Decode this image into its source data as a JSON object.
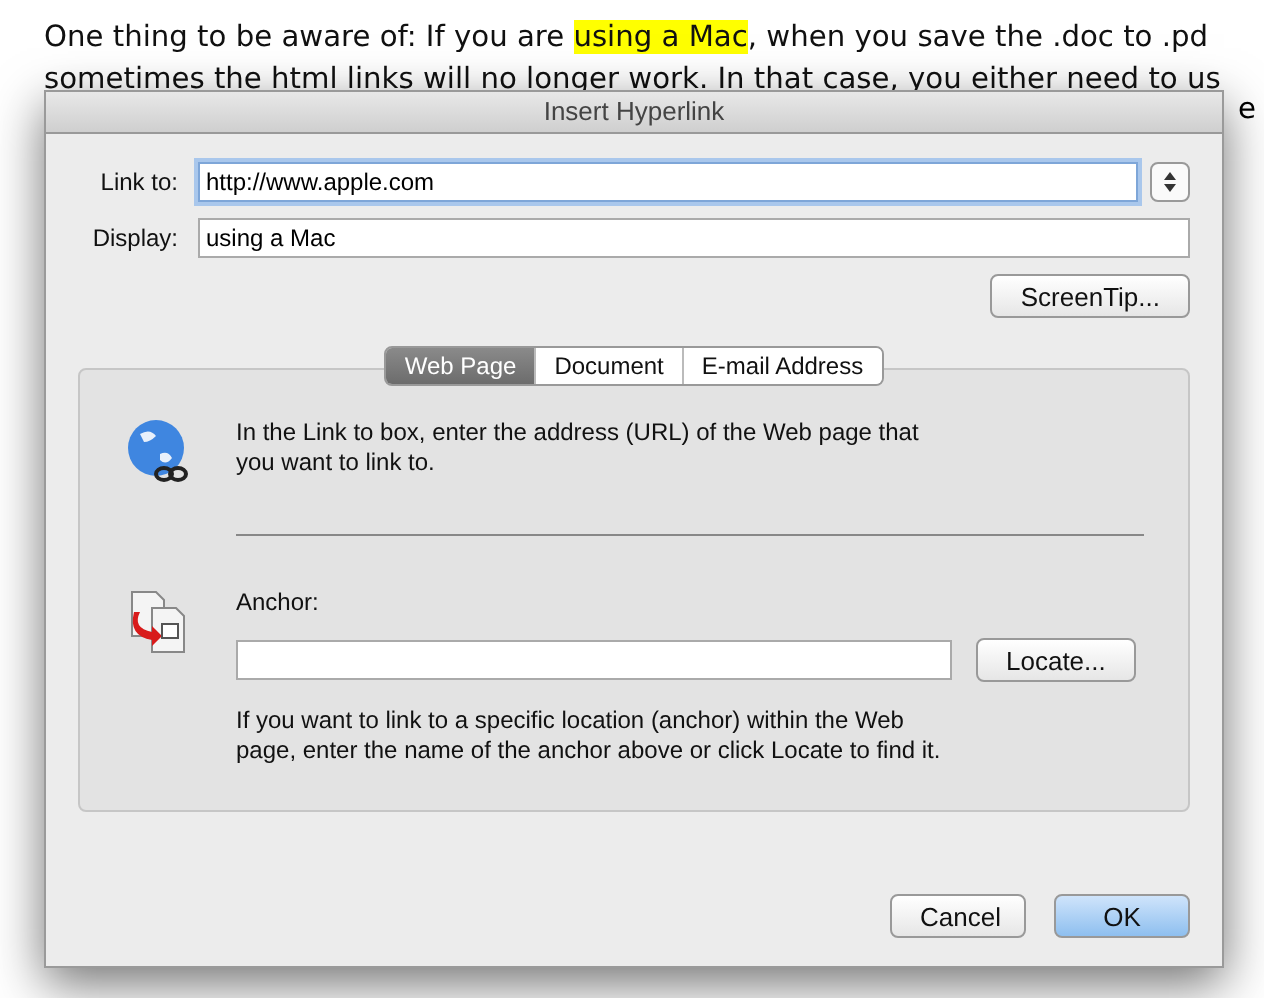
{
  "document": {
    "lines": [
      [
        {
          "text": "One thing to be aware of: If you are ",
          "highlighted": false
        },
        {
          "text": "using a Mac",
          "highlighted": true
        },
        {
          "text": ", when you save the .doc to .pd",
          "highlighted": false
        }
      ],
      [
        {
          "text": "sometimes the html links will no longer work. In that case, you either need to us",
          "highlighted": false
        }
      ]
    ],
    "fragment": "e"
  },
  "dialog": {
    "title": "Insert Hyperlink",
    "link_to": {
      "label": "Link to:",
      "value": "http://www.apple.com"
    },
    "display": {
      "label": "Display:",
      "value": "using a Mac"
    },
    "screentip_button": "ScreenTip...",
    "tabs": [
      {
        "label": "Web Page",
        "selected": true
      },
      {
        "label": "Document",
        "selected": false
      },
      {
        "label": "E-mail Address",
        "selected": false
      }
    ],
    "web_page_panel": {
      "instructions": "In the Link to box, enter the address (URL) of the Web page that you want to link to.",
      "anchor": {
        "label": "Anchor:"
      },
      "locate_button": "Locate...",
      "anchor_help": "If you want to link to a specific location (anchor) within the Web page, enter the name of the anchor above or click Locate to find it."
    },
    "buttons": [
      {
        "label": "Cancel",
        "default": false
      },
      {
        "label": "OK",
        "default": true
      }
    ]
  }
}
